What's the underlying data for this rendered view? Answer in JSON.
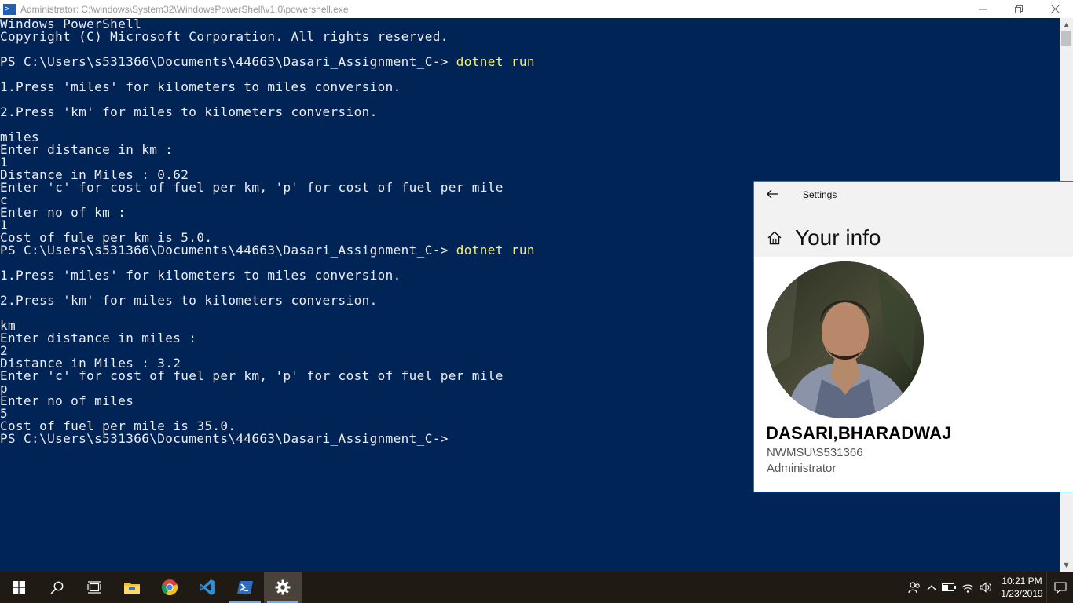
{
  "powershell": {
    "title": "Administrator: C:\\windows\\System32\\WindowsPowerShell\\v1.0\\powershell.exe",
    "icon": "powershell-icon",
    "lines": [
      {
        "text": "Windows PowerShell"
      },
      {
        "text": "Copyright (C) Microsoft Corporation. All rights reserved."
      },
      {
        "text": ""
      },
      {
        "text": "PS C:\\Users\\s531366\\Documents\\44663\\Dasari_Assignment_C-> ",
        "cmd": "dotnet run"
      },
      {
        "text": ""
      },
      {
        "text": "1.Press 'miles' for kilometers to miles conversion."
      },
      {
        "text": ""
      },
      {
        "text": "2.Press 'km' for miles to kilometers conversion."
      },
      {
        "text": ""
      },
      {
        "text": "miles"
      },
      {
        "text": "Enter distance in km :"
      },
      {
        "text": "1"
      },
      {
        "text": "Distance in Miles : 0.62"
      },
      {
        "text": "Enter 'c' for cost of fuel per km, 'p' for cost of fuel per mile"
      },
      {
        "text": "c"
      },
      {
        "text": "Enter no of km :"
      },
      {
        "text": "1"
      },
      {
        "text": "Cost of fule per km is 5.0."
      },
      {
        "text": "PS C:\\Users\\s531366\\Documents\\44663\\Dasari_Assignment_C-> ",
        "cmd": "dotnet run"
      },
      {
        "text": ""
      },
      {
        "text": "1.Press 'miles' for kilometers to miles conversion."
      },
      {
        "text": ""
      },
      {
        "text": "2.Press 'km' for miles to kilometers conversion."
      },
      {
        "text": ""
      },
      {
        "text": "km"
      },
      {
        "text": "Enter distance in miles :"
      },
      {
        "text": "2"
      },
      {
        "text": "Distance in Miles : 3.2"
      },
      {
        "text": "Enter 'c' for cost of fuel per km, 'p' for cost of fuel per mile"
      },
      {
        "text": "p"
      },
      {
        "text": "Enter no of miles"
      },
      {
        "text": "5"
      },
      {
        "text": "Cost of fuel per mile is 35.0."
      },
      {
        "text": "PS C:\\Users\\s531366\\Documents\\44663\\Dasari_Assignment_C->"
      }
    ],
    "colors": {
      "background": "#012456",
      "text": "#eeedf0",
      "command": "#f5f17a"
    }
  },
  "settings": {
    "app_title": "Settings",
    "page_title": "Your info",
    "user_name": "DASARI,BHARADWAJ",
    "account": "NWMSU\\S531366",
    "role": "Administrator",
    "accent": "#1979ca"
  },
  "taskbar": {
    "apps": [
      {
        "name": "start-button",
        "icon": "windows-logo-icon"
      },
      {
        "name": "search-button",
        "icon": "search-icon"
      },
      {
        "name": "task-view-button",
        "icon": "task-view-icon"
      },
      {
        "name": "file-explorer-button",
        "icon": "folder-icon"
      },
      {
        "name": "chrome-button",
        "icon": "chrome-icon"
      },
      {
        "name": "vscode-button",
        "icon": "vscode-icon"
      },
      {
        "name": "powershell-button",
        "icon": "powershell-icon"
      },
      {
        "name": "settings-button",
        "icon": "gear-icon"
      }
    ],
    "time": "10:21 PM",
    "date": "1/23/2019"
  }
}
